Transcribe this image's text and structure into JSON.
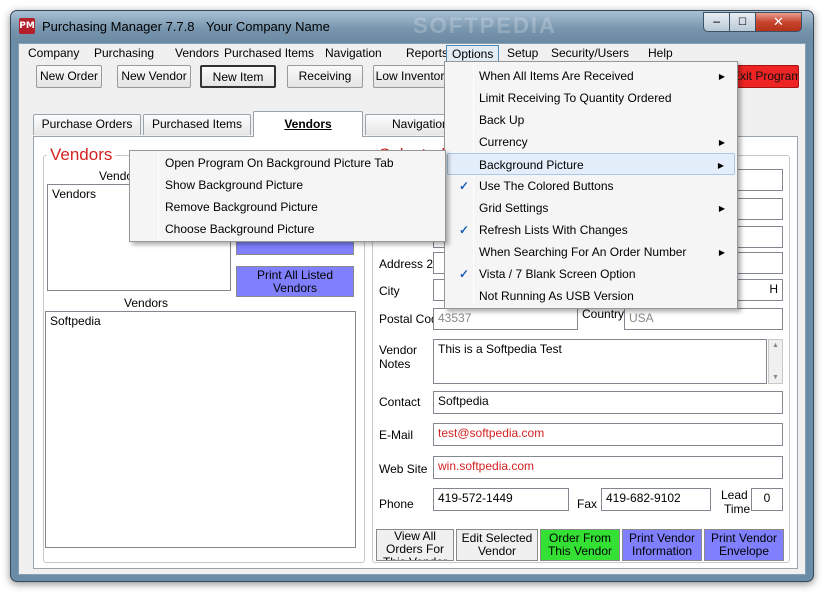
{
  "window": {
    "title": "Purchasing Manager 7.7.8",
    "company": "Your Company Name",
    "watermark": "SOFTPEDIA",
    "app_icon_text": "PM"
  },
  "menubar": [
    "Company",
    "Purchasing",
    "Vendors",
    "Purchased Items",
    "Navigation",
    "Reports",
    "Options",
    "Setup",
    "Security/Users",
    "Help"
  ],
  "toolbar": {
    "new_order": "New Order",
    "new_vendor": "New Vendor",
    "new_item": "New Item",
    "receiving": "Receiving",
    "low_inventory": "Low Inventory",
    "exit_program": "Exit Program"
  },
  "tabs": [
    "Purchase Orders",
    "Purchased Items",
    "Vendors",
    "Navigation"
  ],
  "left_panel": {
    "title": "Vendors",
    "list1_label": "Vendors",
    "list1_items": [
      "Vendors"
    ],
    "print_all_button": "Print All Listed Vendors",
    "list2_label": "Vendors",
    "list2_items": [
      "Softpedia"
    ]
  },
  "right_panel": {
    "title": "Selected Vendor",
    "labels": {
      "address2": "Address 2",
      "city": "City",
      "postal_code": "Postal Code",
      "country": "Country",
      "vendor_notes_1": "Vendor",
      "vendor_notes_2": "Notes",
      "contact": "Contact",
      "email": "E-Mail",
      "web_site": "Web Site",
      "phone": "Phone",
      "fax": "Fax",
      "lead_time_1": "Lead",
      "lead_time_2": "Time"
    },
    "values": {
      "city_partial": "H",
      "postal_code_partial": "43537",
      "country_partial": "USA",
      "notes": "This is a Softpedia Test",
      "contact": "Softpedia",
      "email": "test@softpedia.com",
      "web_site": "win.softpedia.com",
      "phone": "419-572-1449",
      "fax": "419-682-9102",
      "lead_time": "0"
    }
  },
  "bottom_buttons": {
    "view_orders": "View All Orders For This Vendor",
    "edit_selected": "Edit Selected Vendor",
    "order_from": "Order From This Vendor",
    "print_info": "Print Vendor Information",
    "print_envelope": "Print Vendor Envelope"
  },
  "options_menu": [
    {
      "label": "When All Items Are Received",
      "submenu": true,
      "checked": false
    },
    {
      "label": "Limit Receiving To Quantity Ordered",
      "submenu": false,
      "checked": false
    },
    {
      "label": "Back Up",
      "submenu": false,
      "checked": false
    },
    {
      "label": "Currency",
      "submenu": true,
      "checked": false
    },
    {
      "label": "Background Picture",
      "submenu": true,
      "checked": false,
      "highlighted": true
    },
    {
      "label": "Use The Colored Buttons",
      "submenu": false,
      "checked": true
    },
    {
      "label": "Grid Settings",
      "submenu": true,
      "checked": false
    },
    {
      "label": "Refresh Lists With Changes",
      "submenu": false,
      "checked": true
    },
    {
      "label": "When Searching For An Order Number",
      "submenu": true,
      "checked": false
    },
    {
      "label": "Vista / 7 Blank Screen Option",
      "submenu": false,
      "checked": true
    },
    {
      "label": "Not Running As USB Version",
      "submenu": false,
      "checked": false
    }
  ],
  "background_submenu": [
    "Open Program On Background Picture Tab",
    "Show Background Picture",
    "Remove Background Picture",
    "Choose Background Picture"
  ],
  "icons": {
    "checkmark": "checkmark-icon",
    "submenu_arrow": "chevron-right-icon",
    "scroll_up": "scroll-up-icon",
    "scroll_down": "scroll-down-icon"
  },
  "colors": {
    "legend_red": "#d42222",
    "print_button_purple": "#8080ff",
    "order_button_green": "#33e033",
    "exit_button_red": "#ee2424",
    "title_bar": "#7896ae"
  }
}
